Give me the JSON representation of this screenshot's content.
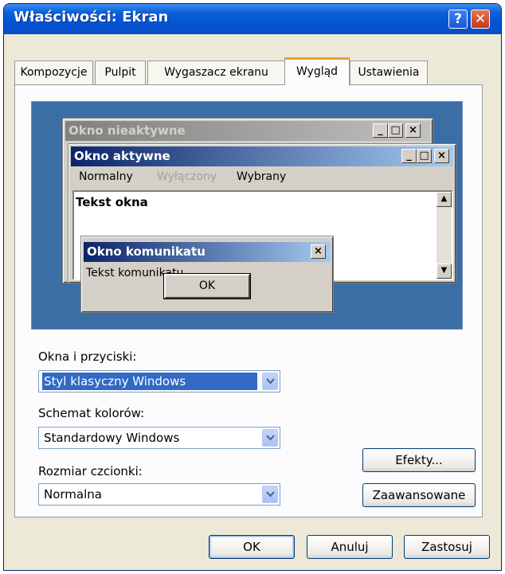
{
  "window": {
    "title": "Właściwości: Ekran",
    "help_label": "?",
    "close_label": "✕"
  },
  "tabs": [
    {
      "label": "Kompozycje"
    },
    {
      "label": "Pulpit"
    },
    {
      "label": "Wygaszacz ekranu"
    },
    {
      "label": "Wygląd",
      "active": true
    },
    {
      "label": "Ustawienia"
    }
  ],
  "preview": {
    "inactive_title": "Okno nieaktywne",
    "active_title": "Okno aktywne",
    "menu": {
      "normal": "Normalny",
      "disabled": "Wyłączony",
      "selected": "Wybrany"
    },
    "window_text": "Tekst okna",
    "message_title": "Okno komunikatu",
    "message_text": "Tekst komunikatu",
    "ok_label": "OK"
  },
  "form": {
    "windows_buttons_label": "Okna i przyciski:",
    "windows_buttons_value": "Styl klasyczny Windows",
    "color_scheme_label": "Schemat kolorów:",
    "color_scheme_value": "Standardowy Windows",
    "font_size_label": "Rozmiar czcionki:",
    "font_size_value": "Normalna",
    "effects_label": "Efekty...",
    "advanced_label": "Zaawansowane"
  },
  "footer": {
    "ok": "OK",
    "cancel": "Anuluj",
    "apply": "Zastosuj"
  },
  "colors": {
    "titlebar": "#0554d6",
    "desktop": "#3a6ea5",
    "active_caption": "#0a246a",
    "selection": "#316ac5",
    "tab_highlight": "#e6a133"
  }
}
